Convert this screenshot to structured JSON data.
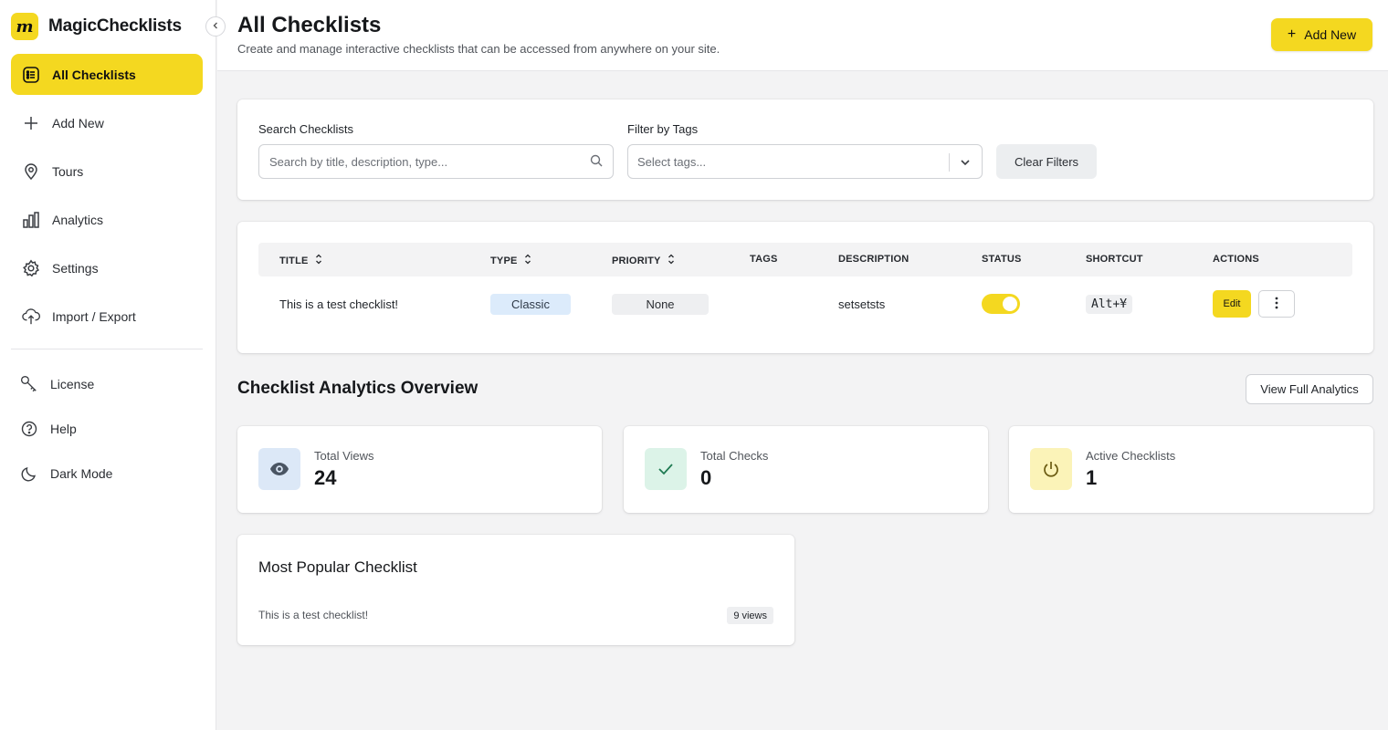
{
  "brand": {
    "logo_letter": "m",
    "name": "MagicChecklists"
  },
  "sidebar": {
    "items": [
      {
        "label": "All Checklists",
        "icon": "list-icon",
        "active": true
      },
      {
        "label": "Add New",
        "icon": "plus-icon"
      },
      {
        "label": "Tours",
        "icon": "map-pin-icon"
      },
      {
        "label": "Analytics",
        "icon": "bar-chart-icon"
      },
      {
        "label": "Settings",
        "icon": "gear-icon"
      },
      {
        "label": "Import / Export",
        "icon": "cloud-upload-icon"
      }
    ],
    "secondary": [
      {
        "label": "License",
        "icon": "key-icon"
      },
      {
        "label": "Help",
        "icon": "help-circle-icon"
      },
      {
        "label": "Dark Mode",
        "icon": "moon-icon"
      }
    ]
  },
  "header": {
    "title": "All Checklists",
    "subtitle": "Create and manage interactive checklists that can be accessed from anywhere on your site.",
    "add_new_label": "Add New"
  },
  "filters": {
    "search_label": "Search Checklists",
    "search_placeholder": "Search by title, description, type...",
    "tags_label": "Filter by Tags",
    "tags_placeholder": "Select tags...",
    "clear_label": "Clear Filters"
  },
  "table": {
    "columns": [
      "TITLE",
      "TYPE",
      "PRIORITY",
      "TAGS",
      "DESCRIPTION",
      "STATUS",
      "SHORTCUT",
      "ACTIONS"
    ],
    "rows": [
      {
        "title": "This is a test checklist!",
        "type": "Classic",
        "priority": "None",
        "tags": "",
        "description": "setsetsts",
        "status_on": true,
        "shortcut": "Alt+¥",
        "edit_label": "Edit"
      }
    ]
  },
  "analytics": {
    "title": "Checklist Analytics Overview",
    "view_full_label": "View Full Analytics",
    "stats": [
      {
        "label": "Total Views",
        "value": "24",
        "icon": "eye-icon",
        "icon_bg": "#dce8f7",
        "icon_color": "#4a5563"
      },
      {
        "label": "Total Checks",
        "value": "0",
        "icon": "check-icon",
        "icon_bg": "#dcf3e8",
        "icon_color": "#1f7a52"
      },
      {
        "label": "Active Checklists",
        "value": "1",
        "icon": "power-icon",
        "icon_bg": "#fbf3b8",
        "icon_color": "#6b5b12"
      }
    ],
    "most_popular": {
      "title": "Most Popular Checklist",
      "name": "This is a test checklist!",
      "views": "9 views"
    }
  },
  "colors": {
    "accent": "#f4d820",
    "background": "#f3f3f4"
  }
}
